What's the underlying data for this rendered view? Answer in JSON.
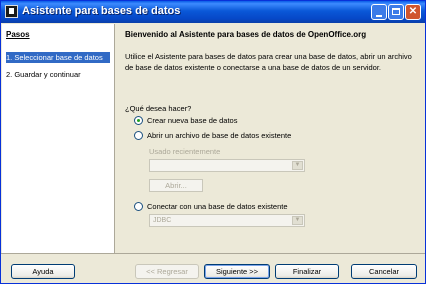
{
  "window": {
    "title": "Asistente para bases de datos"
  },
  "sidebar": {
    "heading": "Pasos",
    "items": [
      {
        "label": "1. Seleccionar base de datos",
        "selected": true
      },
      {
        "label": "2. Guardar y continuar",
        "selected": false
      }
    ]
  },
  "main": {
    "heading": "Bienvenido al Asistente para bases de datos de OpenOffice.org",
    "description": "Utilice el Asistente para bases de datos para crear una base de datos, abrir un archivo de base de datos existente o conectarse a una base de datos de un servidor.",
    "question": "¿Qué desea hacer?",
    "options": [
      {
        "label": "Crear nueva base de datos",
        "selected": true
      },
      {
        "label": "Abrir un archivo de base de datos existente",
        "selected": false
      },
      {
        "label": "Conectar con una base de datos existente",
        "selected": false
      }
    ],
    "recent_label": "Usado recientemente",
    "recent_value": "",
    "open_button": "Abrir...",
    "connect_value": "JDBC"
  },
  "buttons": {
    "help": "Ayuda",
    "back": "<< Regresar",
    "next": "Siguiente >>",
    "finish": "Finalizar",
    "cancel": "Cancelar"
  },
  "colors": {
    "selection": "#316ac5",
    "titlebar": "#0a58d8",
    "dialog_bg": "#ece9d8"
  }
}
